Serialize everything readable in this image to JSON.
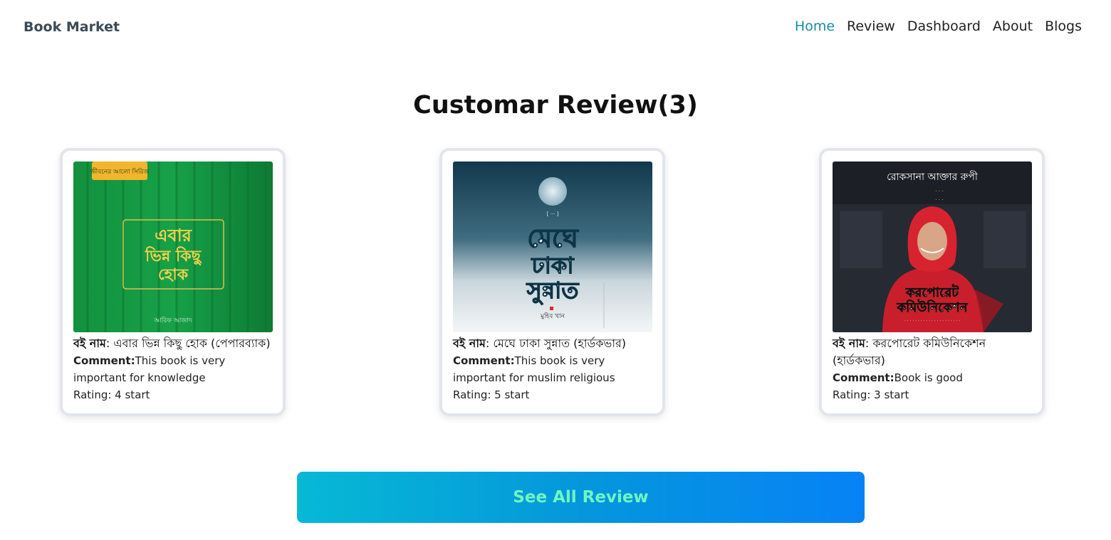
{
  "header": {
    "brand": "Book Market",
    "nav": [
      "Home",
      "Review",
      "Dashboard",
      "About",
      "Blogs"
    ],
    "active_color": "#1a8ca4"
  },
  "main": {
    "title": "Customar Review(3)",
    "reviews": [
      {
        "name_label": "বই নাম",
        "name": ": এবার ভিন্ন কিছু হোক (পেপারব্যাক)",
        "comment_label": "Comment:",
        "comment": "This book is very important for knowledge",
        "rating": "Rating: 4 start",
        "cover": {
          "badge": "জীবনের আলো সিরিজ",
          "title_lines": [
            "এবার",
            "ভিন্ন কিছু",
            "হোক"
          ],
          "author": "আরিফ আজাদ",
          "colors": [
            "#159b43",
            "#0b6e2d"
          ]
        }
      },
      {
        "name_label": "বই নাম",
        "name": ": মেঘে ঢাকা সুন্নাত (হার্ডকভার)",
        "comment_label": "Comment:",
        "comment": "This book is very important for muslim religious",
        "rating": "Rating: 5 start",
        "cover": {
          "title_lines": [
            "মেঘে",
            "ঢাকা",
            "সুন্নাত"
          ],
          "author": "মুহিব খান",
          "colors": [
            "#0f3a4e",
            "#eef1f3"
          ]
        }
      },
      {
        "name_label": "বই নাম",
        "name": ": করপোরেট কমিউনিকেশন (হার্ডকভার)",
        "comment_label": "Comment:",
        "comment": "Book is good",
        "rating": "Rating: 3 start",
        "cover": {
          "author": "রোকসানা আক্তার রুপী",
          "title_lines": [
            "করপোরেট",
            "কমিউনিকেশন"
          ],
          "colors": [
            "#1b1e25",
            "#d2202d"
          ]
        }
      }
    ]
  },
  "footer": {
    "see_all_label": "See All Review"
  }
}
